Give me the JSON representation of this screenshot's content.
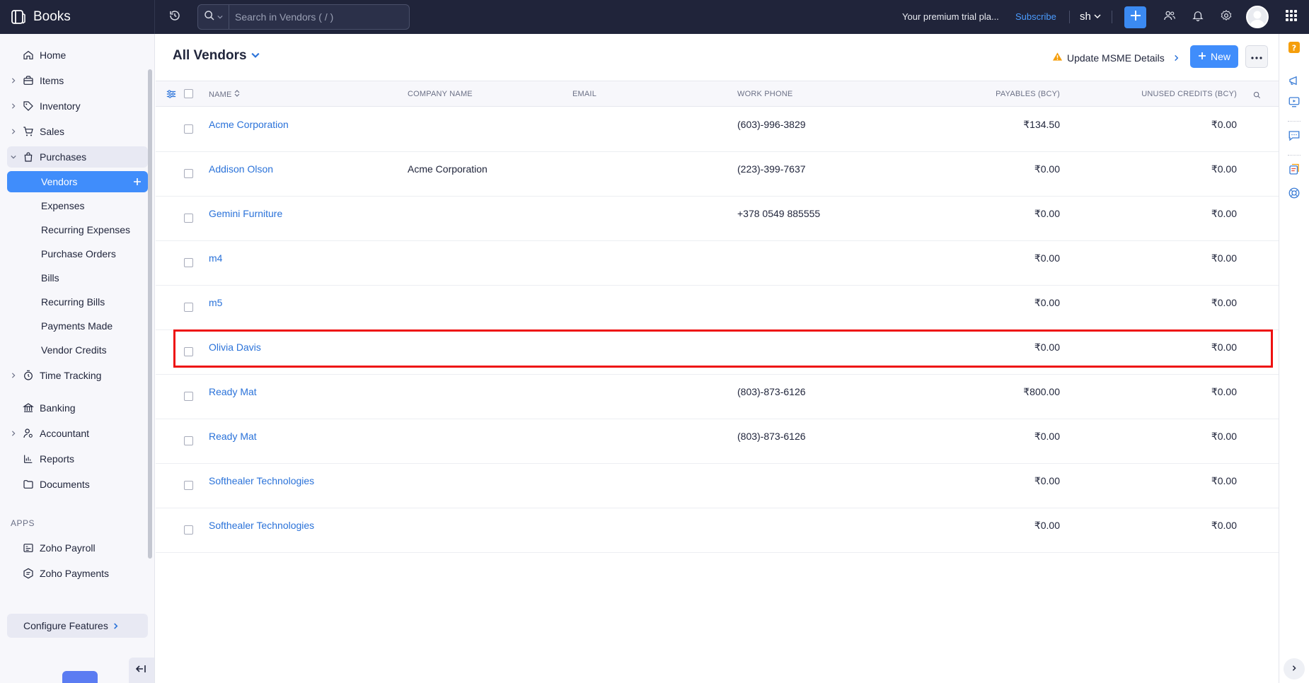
{
  "app": {
    "name": "Books"
  },
  "search": {
    "placeholder": "Search in Vendors ( / )"
  },
  "topbar": {
    "trial_text": "Your premium trial pla...",
    "subscribe_label": "Subscribe",
    "org_label": "sh"
  },
  "sidebar": {
    "items": [
      {
        "label": "Home",
        "icon": "home-icon"
      },
      {
        "label": "Items",
        "icon": "shopping-bag-icon"
      },
      {
        "label": "Inventory",
        "icon": "tag-icon"
      },
      {
        "label": "Sales",
        "icon": "cart-icon"
      },
      {
        "label": "Purchases",
        "icon": "bag-icon"
      },
      {
        "label": "Time Tracking",
        "icon": "stopwatch-icon"
      },
      {
        "label": "Banking",
        "icon": "bank-icon"
      },
      {
        "label": "Accountant",
        "icon": "user-gear-icon"
      },
      {
        "label": "Reports",
        "icon": "bar-chart-icon"
      },
      {
        "label": "Documents",
        "icon": "folder-icon"
      }
    ],
    "purchases_sub": [
      "Vendors",
      "Expenses",
      "Recurring Expenses",
      "Purchase Orders",
      "Bills",
      "Recurring Bills",
      "Payments Made",
      "Vendor Credits"
    ],
    "apps_heading": "APPS",
    "apps": [
      {
        "label": "Zoho Payroll",
        "icon": "payroll-icon"
      },
      {
        "label": "Zoho Payments",
        "icon": "payments-icon"
      }
    ],
    "configure_label": "Configure Features"
  },
  "page": {
    "title": "All Vendors",
    "msme_label": "Update MSME Details",
    "new_label": "New"
  },
  "table": {
    "columns": [
      "NAME",
      "COMPANY NAME",
      "EMAIL",
      "WORK PHONE",
      "PAYABLES (BCY)",
      "UNUSED CREDITS (BCY)"
    ],
    "rows": [
      {
        "name": "Acme Corporation",
        "company": "",
        "email": "",
        "phone": "(603)-996-3829",
        "payables": "₹134.50",
        "credits": "₹0.00"
      },
      {
        "name": "Addison Olson",
        "company": "Acme Corporation",
        "email": "",
        "phone": "(223)-399-7637",
        "payables": "₹0.00",
        "credits": "₹0.00"
      },
      {
        "name": "Gemini Furniture",
        "company": "",
        "email": "",
        "phone": "+378 0549 885555",
        "payables": "₹0.00",
        "credits": "₹0.00"
      },
      {
        "name": "m4",
        "company": "",
        "email": "",
        "phone": "",
        "payables": "₹0.00",
        "credits": "₹0.00"
      },
      {
        "name": "m5",
        "company": "",
        "email": "",
        "phone": "",
        "payables": "₹0.00",
        "credits": "₹0.00"
      },
      {
        "name": "Olivia Davis",
        "company": "",
        "email": "",
        "phone": "",
        "payables": "₹0.00",
        "credits": "₹0.00"
      },
      {
        "name": "Ready Mat",
        "company": "",
        "email": "",
        "phone": "(803)-873-6126",
        "payables": "₹800.00",
        "credits": "₹0.00"
      },
      {
        "name": "Ready Mat",
        "company": "",
        "email": "",
        "phone": "(803)-873-6126",
        "payables": "₹0.00",
        "credits": "₹0.00"
      },
      {
        "name": "Softhealer Technologies",
        "company": "",
        "email": "",
        "phone": "",
        "payables": "₹0.00",
        "credits": "₹0.00"
      },
      {
        "name": "Softhealer Technologies",
        "company": "",
        "email": "",
        "phone": "",
        "payables": "₹0.00",
        "credits": "₹0.00"
      }
    ]
  },
  "colors": {
    "topbar_bg": "#20243a",
    "accent": "#408dfb",
    "link": "#2a72d9",
    "highlight_box": "#ee1111",
    "warning": "#f59e0b"
  }
}
